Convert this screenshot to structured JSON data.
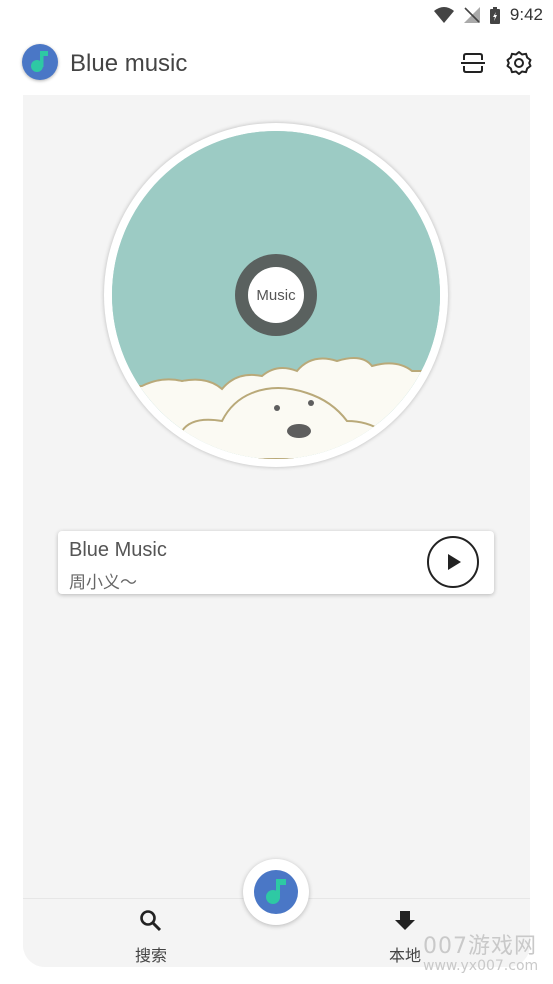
{
  "status_bar": {
    "time": "9:42",
    "icons": [
      "wifi-icon",
      "no-signal-icon",
      "battery-icon"
    ]
  },
  "app_bar": {
    "title": "Blue music",
    "logo_icon": "music-note-icon",
    "actions": [
      "scan-icon",
      "gear-icon"
    ]
  },
  "disc": {
    "center_label": "Music"
  },
  "now_playing": {
    "title": "Blue Music",
    "artist": "周小义～",
    "action_icon": "play-icon"
  },
  "bottom_nav": {
    "search_label": "搜索",
    "local_label": "本地",
    "center_icon": "music-note-icon"
  },
  "watermark": {
    "line1": "007游戏网",
    "line2": "www.yx007.com"
  },
  "colors": {
    "accent": "#4a77c6",
    "note": "#2ec9a4",
    "disc_art": "#9ccbc4",
    "panel": "#f4f4f4"
  }
}
